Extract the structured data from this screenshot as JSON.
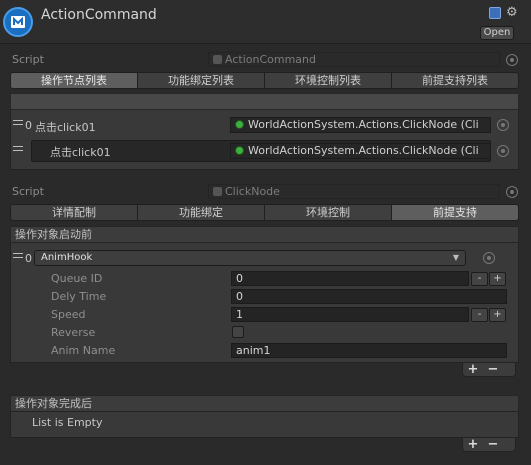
{
  "header": {
    "title": "ActionCommand",
    "open_label": "Open",
    "help_icon": "book-icon",
    "settings_icon": "gear-icon"
  },
  "script_top": {
    "label": "Script",
    "value": "ActionCommand"
  },
  "tabs_top": [
    "操作节点列表",
    "功能绑定列表",
    "环境控制列表",
    "前提支持列表"
  ],
  "node_list": [
    {
      "index": "0",
      "name": "点击click01",
      "ref": "WorldActionSystem.Actions.ClickNode (Cli"
    },
    {
      "index": "",
      "name": "点击click01",
      "ref": "WorldActionSystem.Actions.ClickNode (Cli"
    }
  ],
  "script_node": {
    "label": "Script",
    "value": "ClickNode"
  },
  "tabs_node": [
    "详情配制",
    "功能绑定",
    "环境控制",
    "前提支持"
  ],
  "before_start": {
    "title": "操作对象启动前",
    "index": "0",
    "hook": "AnimHook",
    "fields": {
      "queue_id": {
        "label": "Queue ID",
        "value": "0"
      },
      "dely_time": {
        "label": "Dely Time",
        "value": "0"
      },
      "speed": {
        "label": "Speed",
        "value": "1"
      },
      "reverse": {
        "label": "Reverse",
        "checked": false
      },
      "anim_name": {
        "label": "Anim Name",
        "value": "anim1"
      }
    }
  },
  "after_complete": {
    "title": "操作对象完成后",
    "empty_text": "List is Empty"
  },
  "buttons": {
    "plus": "+",
    "minus": "−"
  }
}
